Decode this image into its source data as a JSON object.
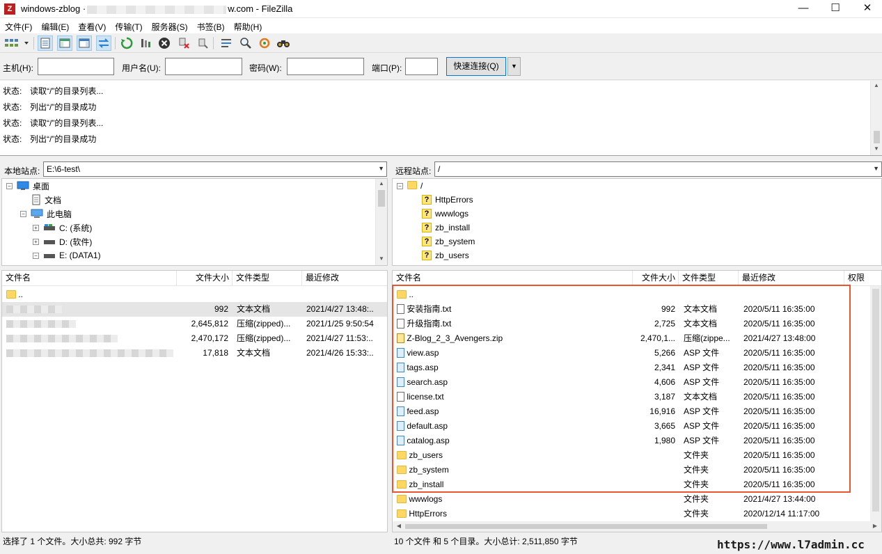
{
  "window": {
    "title_prefix": "windows-zblog ·",
    "title_suffix": "w.com - FileZilla",
    "icon": "filezilla-icon",
    "controls": {
      "minimize": "—",
      "maximize": "☐",
      "close": "✕"
    }
  },
  "menu": [
    "文件(F)",
    "编辑(E)",
    "查看(V)",
    "传输(T)",
    "服务器(S)",
    "书签(B)",
    "帮助(H)"
  ],
  "quickconnect": {
    "host_label": "主机(H):",
    "user_label": "用户名(U):",
    "pass_label": "密码(W):",
    "port_label": "端口(P):",
    "button": "快速连接(Q)",
    "host_value": "",
    "user_value": "",
    "pass_value": "",
    "port_value": ""
  },
  "log": [
    {
      "label": "状态:",
      "text": "读取“/”的目录列表..."
    },
    {
      "label": "状态:",
      "text": "列出“/”的目录成功"
    },
    {
      "label": "状态:",
      "text": "读取“/”的目录列表..."
    },
    {
      "label": "状态:",
      "text": "列出“/”的目录成功"
    }
  ],
  "local": {
    "site_label": "本地站点:",
    "path": "E:\\6-test\\",
    "tree": [
      {
        "label": "桌面",
        "icon": "desktop-icon",
        "exp": "−"
      },
      {
        "label": "文档",
        "icon": "document-icon",
        "exp": ""
      },
      {
        "label": "此电脑",
        "icon": "computer-icon",
        "exp": "−"
      },
      {
        "label": "C: (系统)",
        "icon": "drive-icon",
        "exp": "+"
      },
      {
        "label": "D: (软件)",
        "icon": "drive-icon",
        "exp": "+"
      },
      {
        "label": "E: (DATA1)",
        "icon": "drive-icon",
        "exp": "−"
      }
    ],
    "columns": {
      "name": "文件名",
      "size": "文件大小",
      "type": "文件类型",
      "modified": "最近修改"
    },
    "files": [
      {
        "name": "..",
        "size": "",
        "type": "",
        "modified": "",
        "kind": "folder"
      },
      {
        "name": "",
        "size": "992",
        "type": "文本文档",
        "modified": "2021/4/27 13:48:..",
        "kind": "txt"
      },
      {
        "name": "",
        "size": "2,645,812",
        "type": "压缩(zipped)...",
        "modified": "2021/1/25 9:50:54",
        "kind": "zip"
      },
      {
        "name": "",
        "size": "2,470,172",
        "type": "压缩(zipped)...",
        "modified": "2021/4/27 11:53:..",
        "kind": "zip"
      },
      {
        "name": "",
        "size": "17,818",
        "type": "文本文档",
        "modified": "2021/4/26 15:33:..",
        "kind": "txt"
      }
    ],
    "status": "选择了 1 个文件。大小总共: 992 字节"
  },
  "remote": {
    "site_label": "远程站点:",
    "path": "/",
    "tree": [
      {
        "label": "/",
        "icon": "folder-icon",
        "exp": "−"
      },
      {
        "label": "HttpErrors",
        "icon": "unknown-folder-icon",
        "exp": ""
      },
      {
        "label": "wwwlogs",
        "icon": "unknown-folder-icon",
        "exp": ""
      },
      {
        "label": "zb_install",
        "icon": "unknown-folder-icon",
        "exp": ""
      },
      {
        "label": "zb_system",
        "icon": "unknown-folder-icon",
        "exp": ""
      },
      {
        "label": "zb_users",
        "icon": "unknown-folder-icon",
        "exp": ""
      }
    ],
    "columns": {
      "name": "文件名",
      "size": "文件大小",
      "type": "文件类型",
      "modified": "最近修改",
      "perms": "权限"
    },
    "files": [
      {
        "name": "..",
        "size": "",
        "type": "",
        "modified": "",
        "kind": "folder"
      },
      {
        "name": "安装指南.txt",
        "size": "992",
        "type": "文本文档",
        "modified": "2020/5/11 16:35:00",
        "kind": "txt"
      },
      {
        "name": "升级指南.txt",
        "size": "2,725",
        "type": "文本文档",
        "modified": "2020/5/11 16:35:00",
        "kind": "txt"
      },
      {
        "name": "Z-Blog_2_3_Avengers.zip",
        "size": "2,470,1...",
        "type": "压缩(zippe...",
        "modified": "2021/4/27 13:48:00",
        "kind": "zip"
      },
      {
        "name": "view.asp",
        "size": "5,266",
        "type": "ASP 文件",
        "modified": "2020/5/11 16:35:00",
        "kind": "asp"
      },
      {
        "name": "tags.asp",
        "size": "2,341",
        "type": "ASP 文件",
        "modified": "2020/5/11 16:35:00",
        "kind": "asp"
      },
      {
        "name": "search.asp",
        "size": "4,606",
        "type": "ASP 文件",
        "modified": "2020/5/11 16:35:00",
        "kind": "asp"
      },
      {
        "name": "license.txt",
        "size": "3,187",
        "type": "文本文档",
        "modified": "2020/5/11 16:35:00",
        "kind": "txt"
      },
      {
        "name": "feed.asp",
        "size": "16,916",
        "type": "ASP 文件",
        "modified": "2020/5/11 16:35:00",
        "kind": "asp"
      },
      {
        "name": "default.asp",
        "size": "3,665",
        "type": "ASP 文件",
        "modified": "2020/5/11 16:35:00",
        "kind": "asp"
      },
      {
        "name": "catalog.asp",
        "size": "1,980",
        "type": "ASP 文件",
        "modified": "2020/5/11 16:35:00",
        "kind": "asp"
      },
      {
        "name": "zb_users",
        "size": "",
        "type": "文件夹",
        "modified": "2020/5/11 16:35:00",
        "kind": "folder"
      },
      {
        "name": "zb_system",
        "size": "",
        "type": "文件夹",
        "modified": "2020/5/11 16:35:00",
        "kind": "folder"
      },
      {
        "name": "zb_install",
        "size": "",
        "type": "文件夹",
        "modified": "2020/5/11 16:35:00",
        "kind": "folder"
      },
      {
        "name": "wwwlogs",
        "size": "",
        "type": "文件夹",
        "modified": "2021/4/27 13:44:00",
        "kind": "folder"
      },
      {
        "name": "HttpErrors",
        "size": "",
        "type": "文件夹",
        "modified": "2020/12/14 11:17:00",
        "kind": "folder"
      }
    ],
    "status": "10 个文件 和 5 个目录。大小总计: 2,511,850 字节"
  },
  "watermark": "https://www.l7admin.cc",
  "colors": {
    "highlight_box": "#e8552f",
    "accent": "#0078d7"
  }
}
